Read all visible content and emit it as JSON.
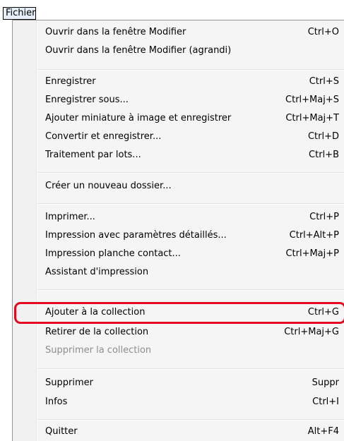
{
  "menu_title": "Fichier",
  "highlight_color": "#e3071f",
  "items": [
    {
      "label": "Ouvrir dans la fenêtre Modifier",
      "shortcut": "Ctrl+O",
      "enabled": true
    },
    {
      "label": "Ouvrir dans la fenêtre Modifier (agrandi)",
      "shortcut": "",
      "enabled": true
    },
    {
      "label": "Enregistrer",
      "shortcut": "Ctrl+S",
      "enabled": true
    },
    {
      "label": "Enregistrer sous...",
      "shortcut": "Ctrl+Maj+S",
      "enabled": true
    },
    {
      "label": "Ajouter miniature à image et enregistrer",
      "shortcut": "Ctrl+Maj+T",
      "enabled": true
    },
    {
      "label": "Convertir et enregistrer...",
      "shortcut": "Ctrl+D",
      "enabled": true
    },
    {
      "label": "Traitement par lots...",
      "shortcut": "Ctrl+B",
      "enabled": true
    },
    {
      "label": "Créer un nouveau dossier...",
      "shortcut": "",
      "enabled": true
    },
    {
      "label": "Imprimer...",
      "shortcut": "Ctrl+P",
      "enabled": true
    },
    {
      "label": "Impression avec paramètres détaillés...",
      "shortcut": "Ctrl+Alt+P",
      "enabled": true
    },
    {
      "label": "Impression planche contact...",
      "shortcut": "Ctrl+Maj+P",
      "enabled": true
    },
    {
      "label": "Assistant d'impression",
      "shortcut": "",
      "enabled": true,
      "submenu": true
    },
    {
      "label": "Ajouter à la collection",
      "shortcut": "Ctrl+G",
      "enabled": true,
      "highlighted": true
    },
    {
      "label": "Retirer de la collection",
      "shortcut": "Ctrl+Maj+G",
      "enabled": true
    },
    {
      "label": "Supprimer la collection",
      "shortcut": "",
      "enabled": false
    },
    {
      "label": "Supprimer",
      "shortcut": "Suppr",
      "enabled": true
    },
    {
      "label": "Infos",
      "shortcut": "Ctrl+I",
      "enabled": true
    },
    {
      "label": "Quitter",
      "shortcut": "Alt+F4",
      "enabled": true
    }
  ]
}
